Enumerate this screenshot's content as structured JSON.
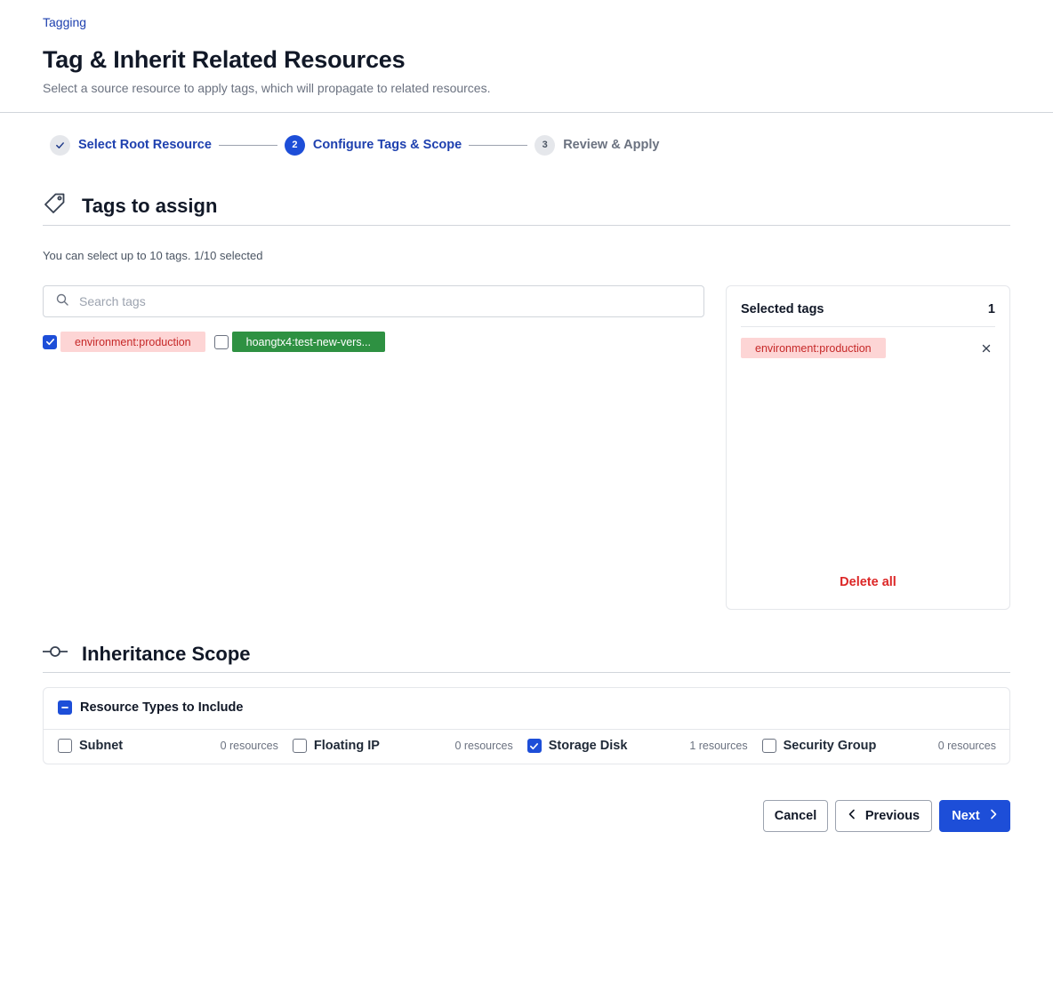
{
  "breadcrumb": "Tagging",
  "header": {
    "title": "Tag & Inherit Related Resources",
    "subtitle": "Select a source resource to apply tags, which will propagate to related resources."
  },
  "stepper": {
    "steps": [
      {
        "number": "",
        "label": "Select Root Resource",
        "state": "done"
      },
      {
        "number": "2",
        "label": "Configure Tags & Scope",
        "state": "active"
      },
      {
        "number": "3",
        "label": "Review & Apply",
        "state": "pending"
      }
    ]
  },
  "tags_section": {
    "title": "Tags to assign",
    "icon": "tag-icon",
    "helper": "You can select up to 10 tags. 1/10 selected",
    "search_placeholder": "Search tags",
    "search_value": "",
    "options": [
      {
        "label": "environment:production",
        "checked": true,
        "color": "#fdd5d5",
        "text_color": "#c62828"
      },
      {
        "label": "hoangtx4:test-new-vers...",
        "checked": false,
        "color": "#2e9142",
        "text_color": "#ffffff"
      }
    ]
  },
  "selected_panel": {
    "title": "Selected tags",
    "count": "1",
    "items": [
      {
        "label": "environment:production"
      }
    ],
    "delete_all": "Delete all"
  },
  "scope_section": {
    "title": "Inheritance Scope",
    "icon": "commit-icon",
    "group_label": "Resource Types to Include",
    "group_state": "indeterminate",
    "items": [
      {
        "name": "Subnet",
        "count": "0 resources",
        "checked": false
      },
      {
        "name": "Floating IP",
        "count": "0 resources",
        "checked": false
      },
      {
        "name": "Storage Disk",
        "count": "1 resources",
        "checked": true
      },
      {
        "name": "Security Group",
        "count": "0 resources",
        "checked": false
      }
    ]
  },
  "actions": {
    "cancel": "Cancel",
    "previous": "Previous",
    "next": "Next"
  },
  "colors": {
    "primary": "#1d4ed8",
    "link": "#1e40af",
    "danger": "#dc2626"
  }
}
